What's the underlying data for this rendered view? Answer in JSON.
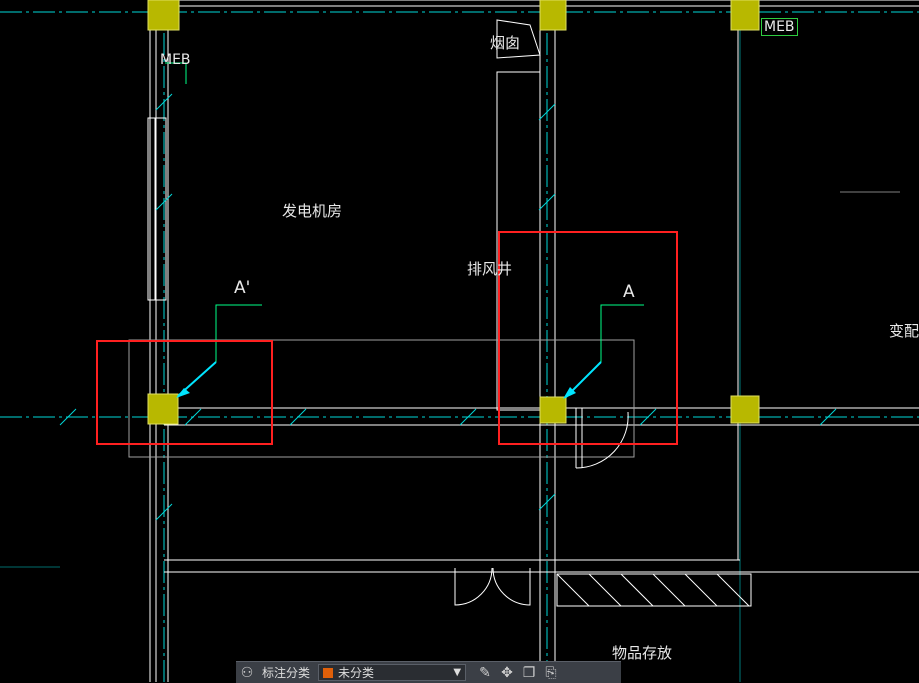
{
  "drawing": {
    "room_labels": {
      "generator_room": "发电机房",
      "exhaust_shaft": "排风井",
      "chimney": "烟囱",
      "storage": "物品存放",
      "substation_partial": "变配"
    },
    "meb_tags": [
      "MEB",
      "MEB"
    ],
    "section_marks": {
      "left": "A'",
      "right": "A"
    },
    "colors": {
      "axis": "#00e5e5",
      "wall": "#ffffff",
      "column": "#c8c800",
      "highlight": "#ff2020",
      "tag_border": "#2ecc40",
      "leader": "#00ff88"
    }
  },
  "toolbar": {
    "label": "标注分类",
    "dropdown_value": "未分类",
    "dropdown_color": "#e0600a",
    "icons": [
      "annotation-icon",
      "edit-icon",
      "move-icon",
      "copy-icon",
      "paste-icon"
    ]
  }
}
